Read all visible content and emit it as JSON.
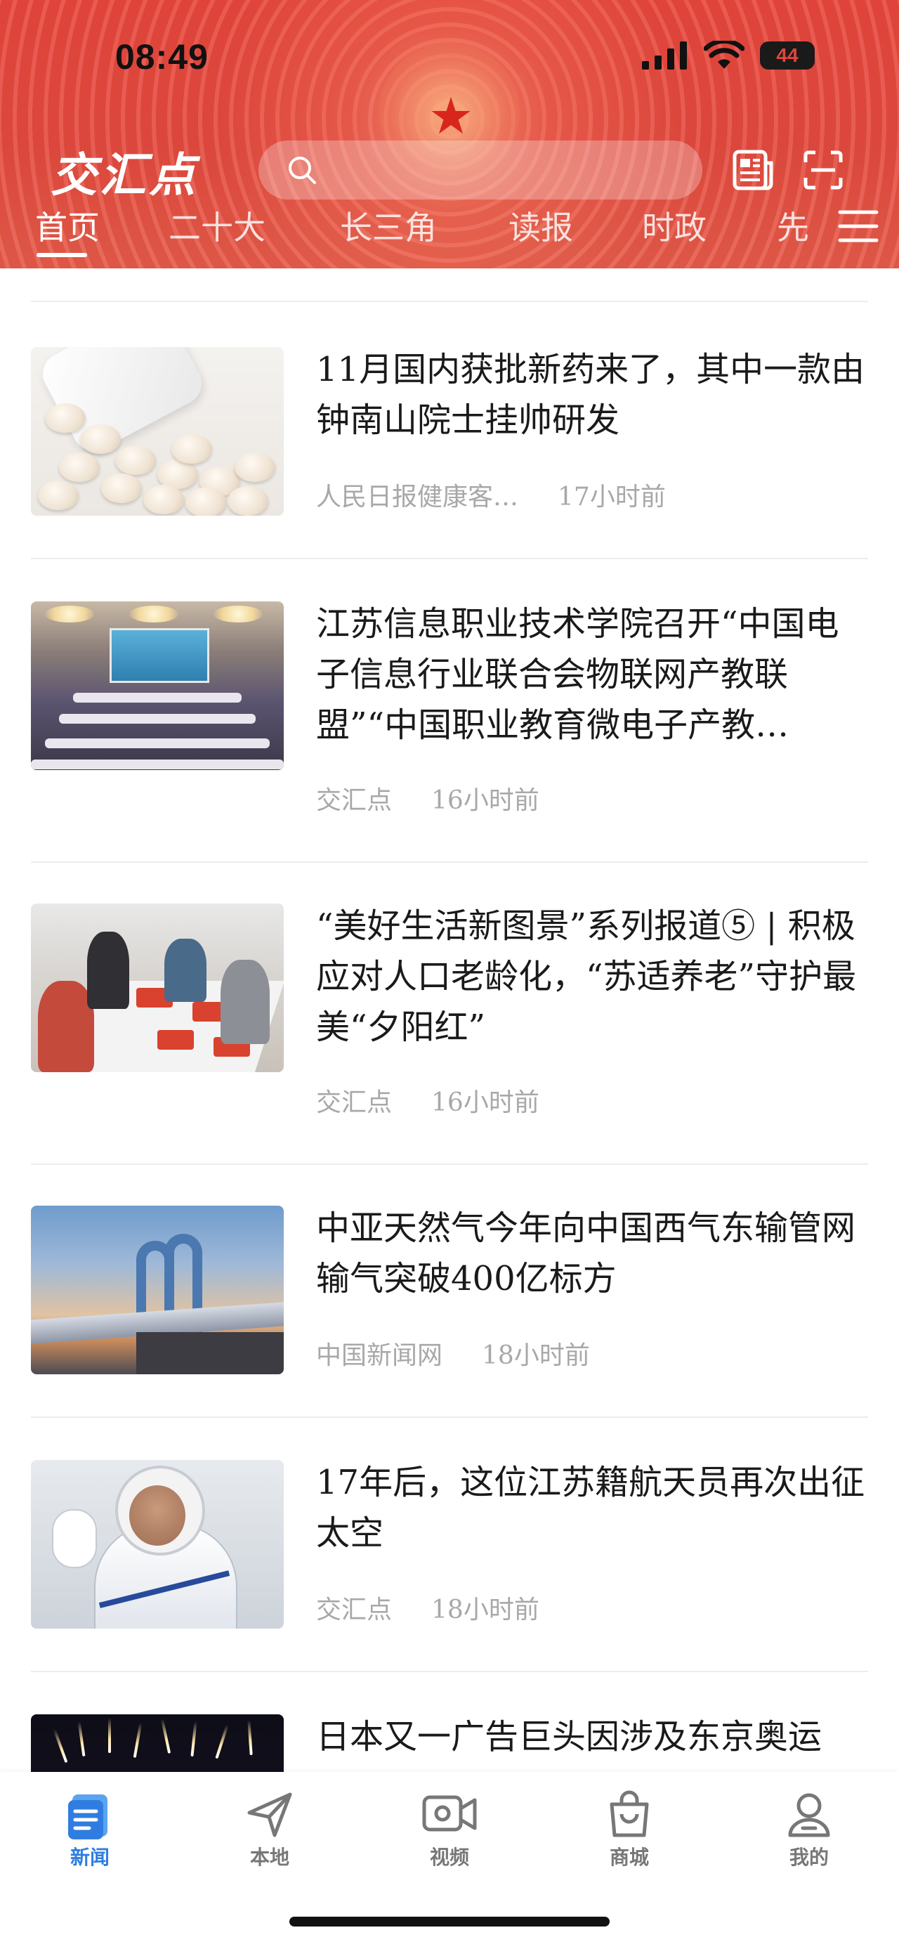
{
  "status_bar": {
    "time": "08:49",
    "battery": "44"
  },
  "header": {
    "logo_text": "交汇点",
    "search_placeholder": "",
    "tabs": [
      {
        "label": "首页",
        "active": true
      },
      {
        "label": "二十大",
        "active": false
      },
      {
        "label": "长三角",
        "active": false
      },
      {
        "label": "读报",
        "active": false
      },
      {
        "label": "时政",
        "active": false
      },
      {
        "label": "先",
        "active": false
      }
    ],
    "colors": {
      "header_red": "#e8473c",
      "active_blue": "#2f7de1"
    }
  },
  "feed": {
    "articles": [
      {
        "title": "11月国内获批新药来了，其中一款由钟南山院士挂帅研发",
        "source": "人民日报健康客…",
        "time": "17小时前",
        "image": "pills-photo"
      },
      {
        "title": "江苏信息职业技术学院召开“中国电子信息行业联合会物联网产教联盟”“中国职业教育微电子产教…",
        "source": "交汇点",
        "time": "16小时前",
        "image": "conference-photo"
      },
      {
        "title": "“美好生活新图景”系列报道⑤ | 积极应对人口老龄化，“苏适养老”守护最美“夕阳红”",
        "source": "交汇点",
        "time": "16小时前",
        "image": "elderly-dining-photo"
      },
      {
        "title": "中亚天然气今年向中国西气东输管网输气突破400亿标方",
        "source": "中国新闻网",
        "time": "18小时前",
        "image": "gas-pipeline-photo"
      },
      {
        "title": "17年后，这位江苏籍航天员再次出征太空",
        "source": "交汇点",
        "time": "18小时前",
        "image": "astronaut-photo"
      },
      {
        "title": "日本又一广告巨头因涉及东京奥运",
        "image": "fireworks-photo"
      }
    ]
  },
  "bottom_nav": {
    "items": [
      {
        "label": "新闻",
        "icon": "news-icon",
        "active": true
      },
      {
        "label": "本地",
        "icon": "paper-plane-icon",
        "active": false
      },
      {
        "label": "视频",
        "icon": "video-camera-icon",
        "active": false
      },
      {
        "label": "商城",
        "icon": "shopping-bag-icon",
        "active": false
      },
      {
        "label": "我的",
        "icon": "user-profile-icon",
        "active": false
      }
    ]
  }
}
